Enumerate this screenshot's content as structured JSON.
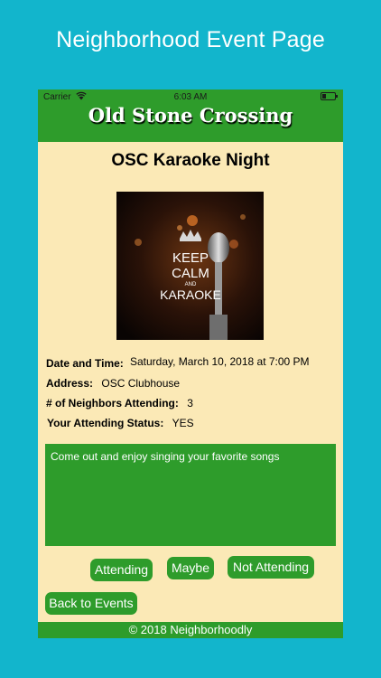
{
  "promo": {
    "title": "Neighborhood Event Page"
  },
  "status_bar": {
    "carrier": "Carrier",
    "time": "6:03 AM"
  },
  "app": {
    "title": "Old Stone Crossing"
  },
  "event": {
    "title": "OSC Karaoke Night",
    "image": {
      "line1": "KEEP",
      "line2": "CALM",
      "line3": "AND",
      "line4": "KARAOKE"
    },
    "date_label": "Date and Time:",
    "date_value": "Saturday, March 10, 2018 at 7:00 PM",
    "address_label": "Address:",
    "address_value": "OSC Clubhouse",
    "attending_label": "# of Neighbors Attending:",
    "attending_value": "3",
    "status_label": "Your Attending Status:",
    "status_value": "YES",
    "description": "Come out and enjoy singing your favorite songs"
  },
  "buttons": {
    "attending": "Attending",
    "maybe": "Maybe",
    "not_attending": "Not Attending",
    "back": "Back to Events"
  },
  "footer": {
    "text": "© 2018 Neighborhoodly"
  },
  "colors": {
    "background": "#12b5cc",
    "accent": "#2e9c2b",
    "panel": "#fbe9b6"
  }
}
